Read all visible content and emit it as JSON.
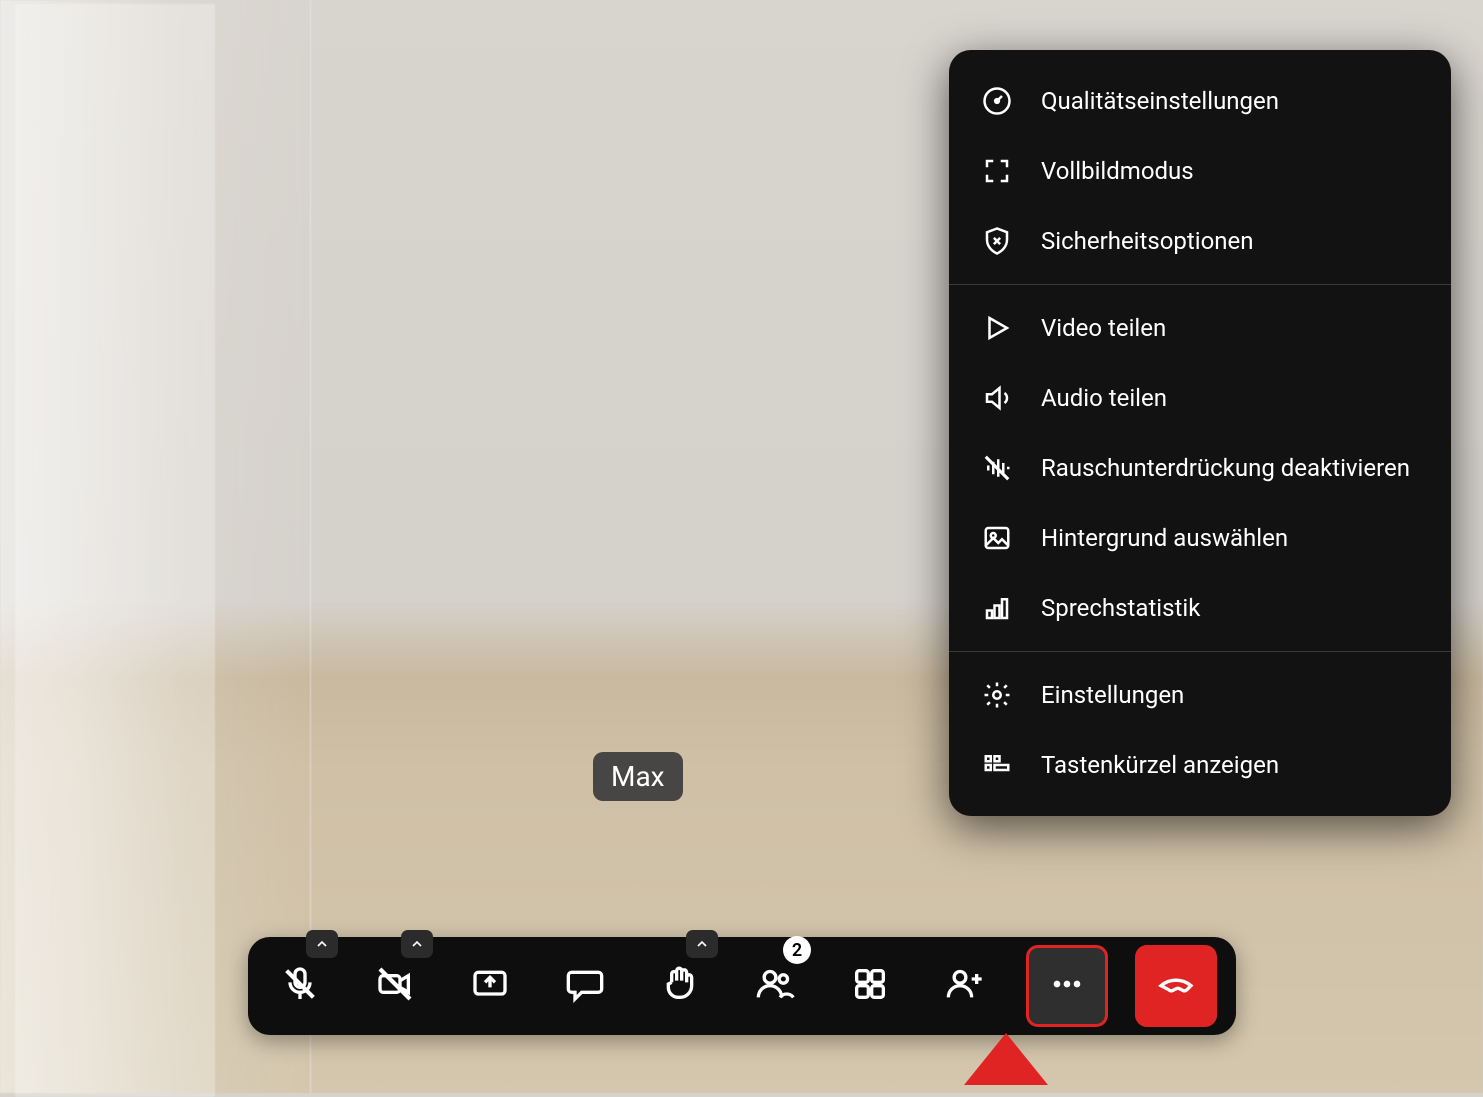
{
  "participant_name": "Max",
  "toolbar": {
    "mic": "microphone-muted",
    "camera": "camera-off",
    "share": "share-screen",
    "chat": "chat",
    "raise_hand": "raise-hand",
    "participants": "participants",
    "participants_count": "2",
    "tiles": "tile-view",
    "invite": "invite",
    "more": "more-actions",
    "hangup": "hangup"
  },
  "menu": {
    "sections": [
      [
        {
          "icon": "gauge",
          "label": "Qualitätseinstellungen"
        },
        {
          "icon": "fullscreen",
          "label": "Vollbildmodus"
        },
        {
          "icon": "shield",
          "label": "Sicherheitsoptionen"
        }
      ],
      [
        {
          "icon": "play",
          "label": "Video teilen"
        },
        {
          "icon": "speaker",
          "label": "Audio teilen"
        },
        {
          "icon": "noise",
          "label": "Rauschunterdrückung deaktivieren"
        },
        {
          "icon": "image",
          "label": "Hintergrund auswählen"
        },
        {
          "icon": "bars",
          "label": "Sprechstatistik"
        }
      ],
      [
        {
          "icon": "gear",
          "label": "Einstellungen"
        },
        {
          "icon": "keyboard",
          "label": "Tastenkürzel anzeigen"
        }
      ]
    ]
  }
}
